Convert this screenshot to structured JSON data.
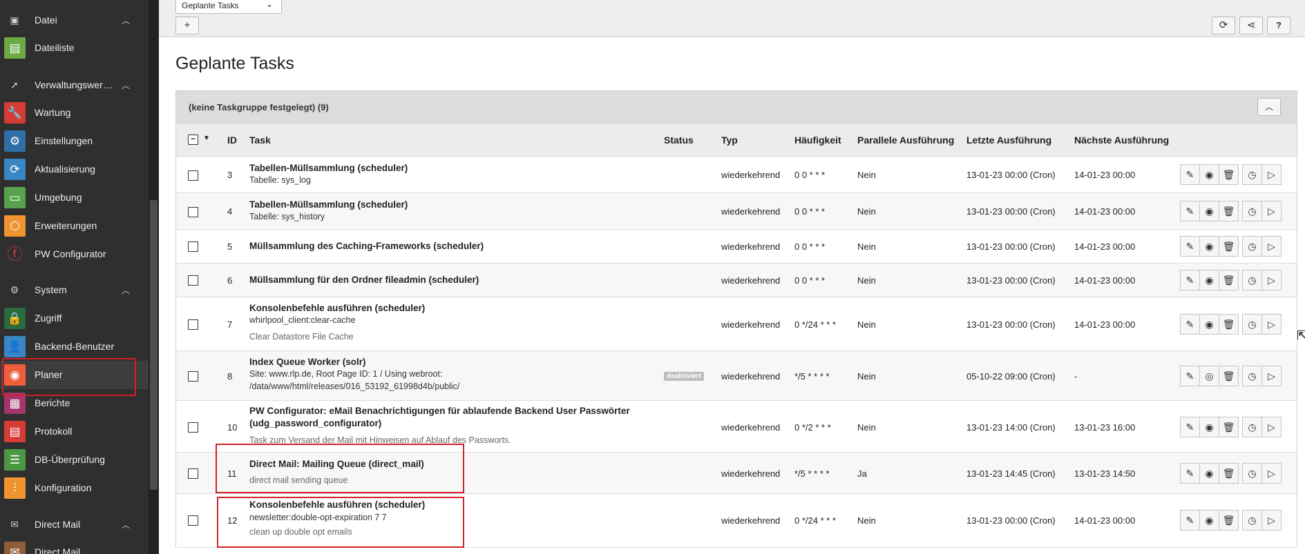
{
  "sidebar": {
    "groups": {
      "datei": {
        "label": "Datei"
      },
      "verwaltung": {
        "label": "Verwaltungswerkzeuge"
      },
      "system": {
        "label": "System"
      },
      "directmail": {
        "label": "Direct Mail"
      }
    },
    "items": {
      "dateiliste": {
        "label": "Dateiliste",
        "color": "#6daa45"
      },
      "wartung": {
        "label": "Wartung",
        "color": "#d63c36"
      },
      "einstellungen": {
        "label": "Einstellungen",
        "color": "#2f6ea6"
      },
      "aktualisierung": {
        "label": "Aktualisierung",
        "color": "#3a85c4"
      },
      "umgebung": {
        "label": "Umgebung",
        "color": "#57a34b"
      },
      "erweiterungen": {
        "label": "Erweiterungen",
        "color": "#f09431"
      },
      "pwconfigurator": {
        "label": "PW Configurator",
        "color": "#d63c36"
      },
      "zugriff": {
        "label": "Zugriff",
        "color": "#2a6c3d"
      },
      "backendbenutzer": {
        "label": "Backend-Benutzer",
        "color": "#3a85c4"
      },
      "planer": {
        "label": "Planer",
        "color": "#ee5d3c"
      },
      "berichte": {
        "label": "Berichte",
        "color": "#a4346a"
      },
      "protokoll": {
        "label": "Protokoll",
        "color": "#d63c36"
      },
      "dbueberpruefung": {
        "label": "DB-Überprüfung",
        "color": "#4d9644"
      },
      "konfiguration": {
        "label": "Konfiguration",
        "color": "#f09431"
      },
      "directmail": {
        "label": "Direct Mail",
        "color": "#8e5d3a"
      }
    }
  },
  "toolbar": {
    "module_select": "Geplante Tasks",
    "add_label": "+",
    "help_label": "?"
  },
  "page": {
    "title": "Geplante Tasks"
  },
  "panel": {
    "title": "(keine Taskgruppe festgelegt) (9)",
    "columns": {
      "id": "ID",
      "task": "Task",
      "status": "Status",
      "typ": "Typ",
      "haeufigkeit": "Häufigkeit",
      "parallel": "Parallele Ausführung",
      "letzte": "Letzte Ausführung",
      "naechste": "Nächste Ausführung"
    },
    "rows": [
      {
        "id": "3",
        "name": "Tabellen-Müllsammlung (scheduler)",
        "sub": "Tabelle: sys_log",
        "typ": "wiederkehrend",
        "freq": "0 0 * * *",
        "parallel": "Nein",
        "last": "13-01-23 00:00 (Cron)",
        "next": "14-01-23 00:00"
      },
      {
        "id": "4",
        "name": "Tabellen-Müllsammlung (scheduler)",
        "sub": "Tabelle: sys_history",
        "typ": "wiederkehrend",
        "freq": "0 0 * * *",
        "parallel": "Nein",
        "last": "13-01-23 00:00 (Cron)",
        "next": "14-01-23 00:00"
      },
      {
        "id": "5",
        "name": "Müllsammlung des Caching-Frameworks (scheduler)",
        "typ": "wiederkehrend",
        "freq": "0 0 * * *",
        "parallel": "Nein",
        "last": "13-01-23 00:00 (Cron)",
        "next": "14-01-23 00:00"
      },
      {
        "id": "6",
        "name": "Müllsammlung für den Ordner fileadmin (scheduler)",
        "typ": "wiederkehrend",
        "freq": "0 0 * * *",
        "parallel": "Nein",
        "last": "13-01-23 00:00 (Cron)",
        "next": "14-01-23 00:00"
      },
      {
        "id": "7",
        "name": "Konsolenbefehle ausführen (scheduler)",
        "sub": "whirlpool_client:clear-cache",
        "desc": "Clear Datastore File Cache",
        "typ": "wiederkehrend",
        "freq": "0 */24 * * *",
        "parallel": "Nein",
        "last": "13-01-23 00:00 (Cron)",
        "next": "14-01-23 00:00"
      },
      {
        "id": "8",
        "name": "Index Queue Worker (solr)",
        "sub": "Site: www.rlp.de, Root Page ID: 1 / Using webroot:",
        "sub2": "/data/www/html/releases/016_53192_61998d4b/public/",
        "status": "deaktiviert",
        "typ": "wiederkehrend",
        "freq": "*/5 * * * *",
        "parallel": "Nein",
        "last": "05-10-22 09:00 (Cron)",
        "next": "-"
      },
      {
        "id": "10",
        "name": "PW Configurator: eMail Benachrichtigungen für ablaufende Backend User Passwörter",
        "name2": "(udg_password_configurator)",
        "desc": "Task zum Versand der Mail mit Hinweisen auf Ablauf des Passworts.",
        "typ": "wiederkehrend",
        "freq": "0 */2 * * *",
        "parallel": "Nein",
        "last": "13-01-23 14:00 (Cron)",
        "next": "13-01-23 16:00"
      },
      {
        "id": "11",
        "name": "Direct Mail: Mailing Queue (direct_mail)",
        "desc": "direct mail sending queue",
        "typ": "wiederkehrend",
        "freq": "*/5 * * * *",
        "parallel": "Ja",
        "last": "13-01-23 14:45 (Cron)",
        "next": "13-01-23 14:50"
      },
      {
        "id": "12",
        "name": "Konsolenbefehle ausführen (scheduler)",
        "sub": "newsletter:double-opt-expiration 7 7",
        "desc": "clean up double opt emails",
        "typ": "wiederkehrend",
        "freq": "0 */24 * * *",
        "parallel": "Nein",
        "last": "13-01-23 00:00 (Cron)",
        "next": "14-01-23 00:00"
      }
    ]
  }
}
